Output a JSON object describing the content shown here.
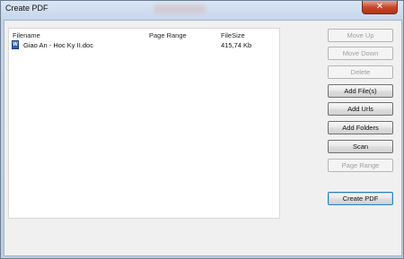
{
  "window": {
    "title": "Create PDF",
    "close_label": "✕"
  },
  "filelist": {
    "columns": {
      "filename": "Filename",
      "page_range": "Page Range",
      "filesize": "FileSize"
    },
    "rows": [
      {
        "filename": "Giao An - Hoc Ky II.doc",
        "page_range": "",
        "filesize": "415,74 Kb",
        "icon": "word-document-icon"
      }
    ]
  },
  "buttons": {
    "move_up": "Move Up",
    "move_down": "Move Down",
    "delete": "Delete",
    "add_files": "Add File(s)",
    "add_urls": "Add Urls",
    "add_folders": "Add Folders",
    "scan": "Scan",
    "page_range": "Page Range",
    "create_pdf": "Create PDF"
  }
}
